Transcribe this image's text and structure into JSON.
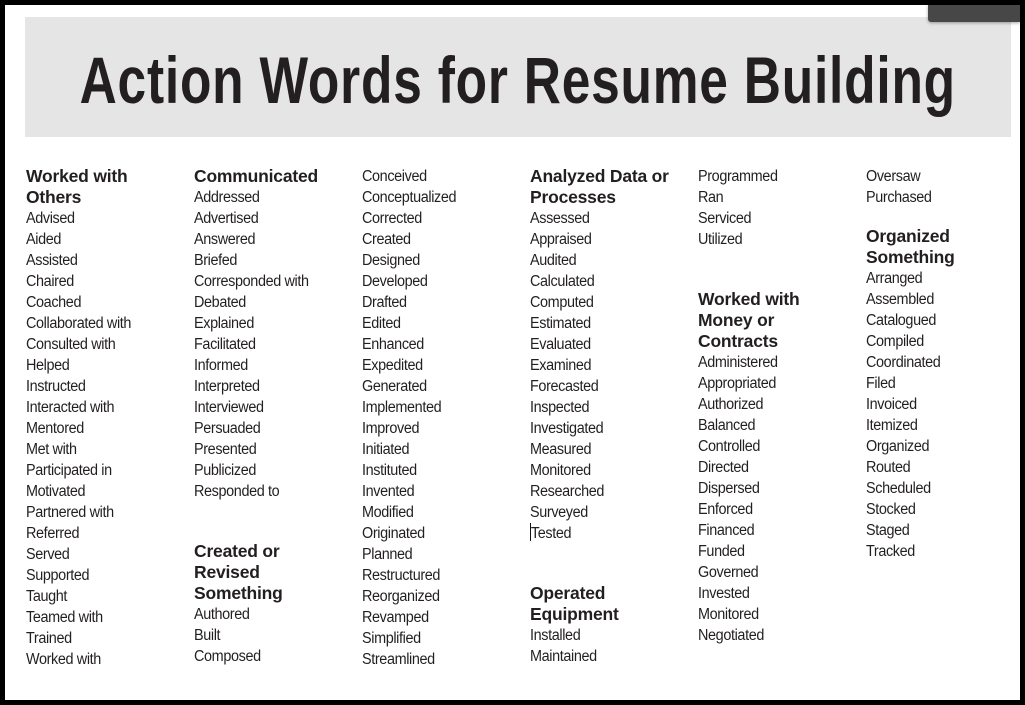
{
  "title": "Action Words for Resume Building",
  "sections": {
    "worked_with_others": {
      "heading_line1": "Worked with",
      "heading_line2": "Others",
      "words": [
        "Advised",
        "Aided",
        "Assisted",
        "Chaired",
        "Coached",
        "Collaborated with",
        "Consulted with",
        "Helped",
        "Instructed",
        "Interacted with",
        "Mentored",
        "Met with",
        "Participated in",
        "Motivated",
        "Partnered with",
        "Referred",
        "Served",
        "Supported",
        "Taught",
        "Teamed with",
        "Trained",
        "Worked with"
      ]
    },
    "communicated": {
      "heading_line1": "Communicated",
      "words": [
        "Addressed",
        "Advertised",
        "Answered",
        "Briefed",
        "Corresponded with",
        "Debated",
        "Explained",
        "Facilitated",
        "Informed",
        "Interpreted",
        "Interviewed",
        "Persuaded",
        "Presented",
        "Publicized",
        "Responded to"
      ]
    },
    "created_or_revised": {
      "heading_line1": "Created or",
      "heading_line2": "Revised",
      "heading_line3": "Something",
      "words": [
        "Authored",
        "Built",
        "Composed",
        "Conceived",
        "Conceptualized",
        "Corrected",
        "Created",
        "Designed",
        "Developed",
        "Drafted",
        "Edited",
        "Enhanced",
        "Expedited",
        "Generated",
        "Implemented",
        "Improved",
        "Initiated",
        "Instituted",
        "Invented",
        "Modified",
        "Originated",
        "Planned",
        "Restructured",
        "Reorganized",
        "Revamped",
        "Simplified",
        "Streamlined"
      ]
    },
    "analyzed_data": {
      "heading_line1": "Analyzed Data or",
      "heading_line2": "Processes",
      "words": [
        "Assessed",
        "Appraised",
        "Audited",
        "Calculated",
        "Computed",
        "Estimated",
        "Evaluated",
        "Examined",
        "Forecasted",
        "Inspected",
        "Investigated",
        "Measured",
        "Monitored",
        "Researched",
        "Surveyed",
        "Tested"
      ]
    },
    "operated_equipment": {
      "heading_line1": "Operated",
      "heading_line2": "Equipment",
      "words": [
        "Installed",
        "Maintained",
        "Programmed",
        "Ran",
        "Serviced",
        "Utilized"
      ]
    },
    "money_contracts": {
      "heading_line1": "Worked with",
      "heading_line2": "Money or",
      "heading_line3": "Contracts",
      "words": [
        "Administered",
        "Appropriated",
        "Authorized",
        "Balanced",
        "Controlled",
        "Directed",
        "Dispersed",
        "Enforced",
        "Financed",
        "Funded",
        "Governed",
        "Invested",
        "Monitored",
        "Negotiated",
        "Oversaw",
        "Purchased"
      ]
    },
    "organized_something": {
      "heading_line1": "Organized",
      "heading_line2": "Something",
      "words": [
        "Arranged",
        "Assembled",
        "Catalogued",
        "Compiled",
        "Coordinated",
        "Filed",
        "Invoiced",
        "Itemized",
        "Organized",
        "Routed",
        "Scheduled",
        "Stocked",
        "Staged",
        "Tracked"
      ]
    }
  }
}
